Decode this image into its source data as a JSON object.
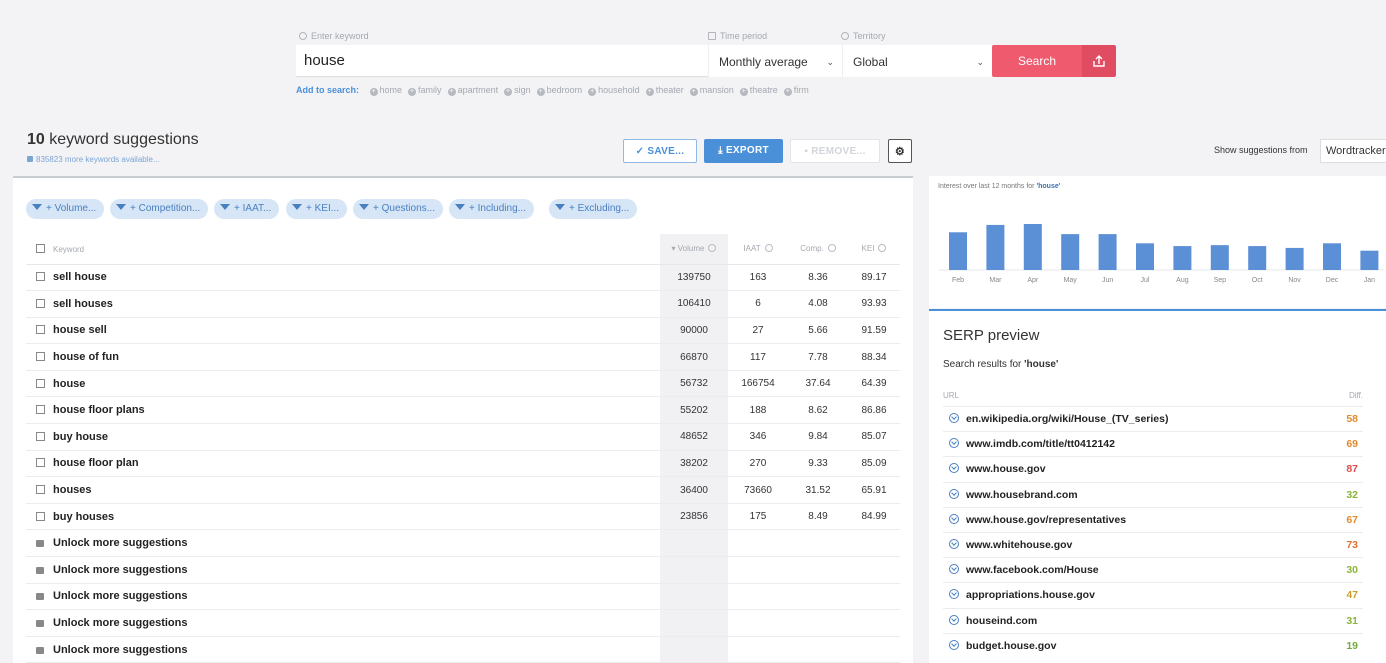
{
  "search": {
    "keyword_label": "Enter keyword",
    "keyword_value": "house",
    "time_label": "Time period",
    "time_value": "Monthly average",
    "territory_label": "Territory",
    "territory_value": "Global",
    "button": "Search",
    "add_label": "Add to search:",
    "add_terms": [
      "home",
      "family",
      "apartment",
      "sign",
      "bedroom",
      "household",
      "theater",
      "mansion",
      "theatre",
      "firm"
    ]
  },
  "results": {
    "count": "10",
    "title_suffix": "keyword suggestions",
    "more": "835823 more keywords available..."
  },
  "actions": {
    "save": "SAVE...",
    "export": "EXPORT",
    "remove": "REMOVE..."
  },
  "filters": [
    "+ Volume...",
    "+ Competition...",
    "+ IAAT...",
    "+ KEI...",
    "+ Questions...",
    "+ Including...",
    "+ Excluding..."
  ],
  "table": {
    "headers": {
      "keyword": "Keyword",
      "volume": "Volume",
      "iaat": "IAAT",
      "comp": "Comp.",
      "kei": "KEI"
    },
    "rows": [
      {
        "keyword": "sell house",
        "volume": "139750",
        "iaat": "163",
        "comp": "8.36",
        "kei": "89.17"
      },
      {
        "keyword": "sell houses",
        "volume": "106410",
        "iaat": "6",
        "comp": "4.08",
        "kei": "93.93"
      },
      {
        "keyword": "house sell",
        "volume": "90000",
        "iaat": "27",
        "comp": "5.66",
        "kei": "91.59"
      },
      {
        "keyword": "house of fun",
        "volume": "66870",
        "iaat": "117",
        "comp": "7.78",
        "kei": "88.34"
      },
      {
        "keyword": "house",
        "volume": "56732",
        "iaat": "166754",
        "comp": "37.64",
        "kei": "64.39"
      },
      {
        "keyword": "house floor plans",
        "volume": "55202",
        "iaat": "188",
        "comp": "8.62",
        "kei": "86.86"
      },
      {
        "keyword": "buy house",
        "volume": "48652",
        "iaat": "346",
        "comp": "9.84",
        "kei": "85.07"
      },
      {
        "keyword": "house floor plan",
        "volume": "38202",
        "iaat": "270",
        "comp": "9.33",
        "kei": "85.09"
      },
      {
        "keyword": "houses",
        "volume": "36400",
        "iaat": "73660",
        "comp": "31.52",
        "kei": "65.91"
      },
      {
        "keyword": "buy houses",
        "volume": "23856",
        "iaat": "175",
        "comp": "8.49",
        "kei": "84.99"
      }
    ],
    "unlock_label": "Unlock more suggestions",
    "unlock_count": 5
  },
  "source": {
    "label": "Show suggestions from",
    "value": "Wordtracker"
  },
  "trend": {
    "title_prefix": "Interest over last 12 months for",
    "title_keyword": "'house'"
  },
  "chart_data": {
    "type": "bar",
    "categories": [
      "Feb",
      "Mar",
      "Apr",
      "May",
      "Jun",
      "Jul",
      "Aug",
      "Sep",
      "Oct",
      "Nov",
      "Dec",
      "Jan"
    ],
    "values": [
      82,
      98,
      100,
      78,
      78,
      58,
      52,
      54,
      52,
      48,
      58,
      42
    ],
    "ylim": [
      0,
      100
    ],
    "color": "#5b8fd6"
  },
  "serp": {
    "title": "SERP preview",
    "sub_prefix": "Search results for",
    "sub_keyword": "'house'",
    "url_header": "URL",
    "diff_header": "Diff.",
    "rows": [
      {
        "url": "en.wikipedia.org/wiki/House_(TV_series)",
        "diff": "58",
        "color": "#e08a2c"
      },
      {
        "url": "www.imdb.com/title/tt0412142",
        "diff": "69",
        "color": "#e08a2c"
      },
      {
        "url": "www.house.gov",
        "diff": "87",
        "color": "#e04c4c"
      },
      {
        "url": "www.housebrand.com",
        "diff": "32",
        "color": "#8ab53a"
      },
      {
        "url": "www.house.gov/representatives",
        "diff": "67",
        "color": "#e08a2c"
      },
      {
        "url": "www.whitehouse.gov",
        "diff": "73",
        "color": "#e0702c"
      },
      {
        "url": "www.facebook.com/House",
        "diff": "30",
        "color": "#8ab53a"
      },
      {
        "url": "appropriations.house.gov",
        "diff": "47",
        "color": "#c9a02a"
      },
      {
        "url": "houseind.com",
        "diff": "31",
        "color": "#8ab53a"
      },
      {
        "url": "budget.house.gov",
        "diff": "19",
        "color": "#6fae3a"
      }
    ]
  }
}
